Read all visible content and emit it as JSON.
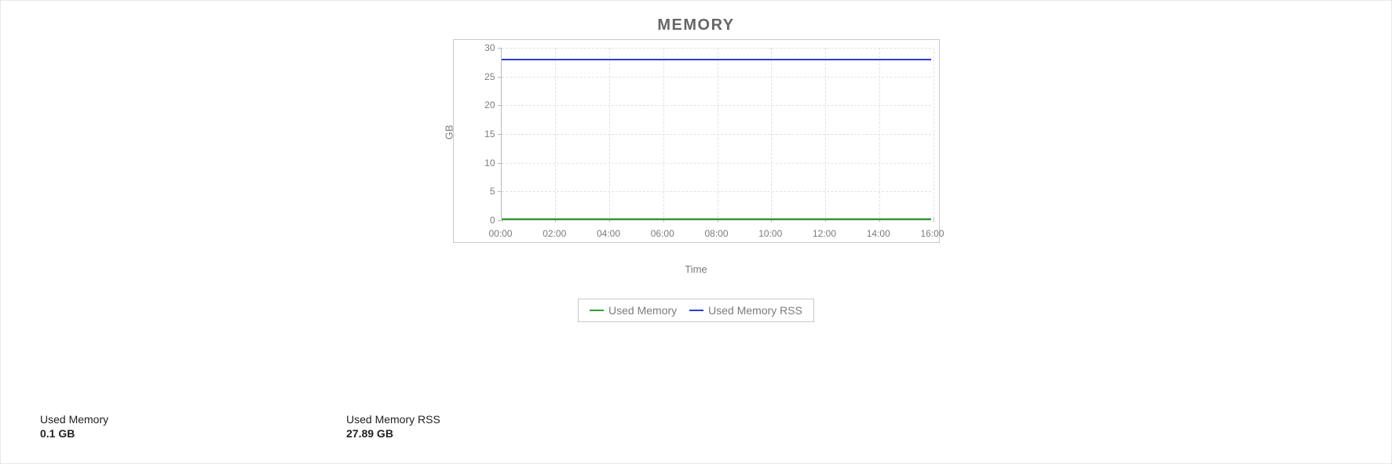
{
  "chart_data": {
    "type": "line",
    "title": "MEMORY",
    "xlabel": "Time",
    "ylabel": "GB",
    "ylim": [
      0,
      30
    ],
    "yticks": [
      0,
      5,
      10,
      15,
      20,
      25,
      30
    ],
    "categories": [
      "00:00",
      "02:00",
      "04:00",
      "06:00",
      "08:00",
      "10:00",
      "12:00",
      "14:00",
      "16:00"
    ],
    "series": [
      {
        "name": "Used Memory",
        "color": "#2e9e2e",
        "values": [
          0.1,
          0.1,
          0.1,
          0.1,
          0.1,
          0.1,
          0.1,
          0.1,
          0.1
        ]
      },
      {
        "name": "Used Memory RSS",
        "color": "#2b3fcf",
        "values": [
          27.89,
          27.89,
          27.89,
          27.89,
          27.89,
          27.89,
          27.89,
          27.89,
          27.89
        ]
      }
    ]
  },
  "stats": [
    {
      "label": "Used Memory",
      "value": "0.1 GB"
    },
    {
      "label": "Used Memory RSS",
      "value": "27.89 GB"
    }
  ]
}
